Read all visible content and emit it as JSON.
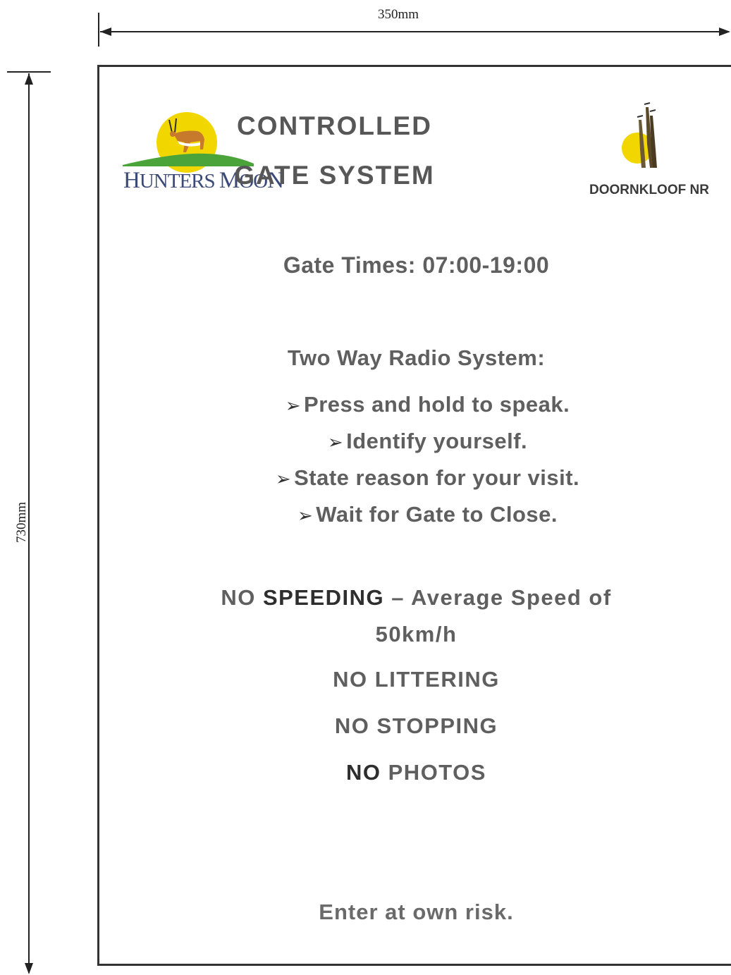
{
  "dimensions": {
    "width_label": "350mm",
    "height_label": "730mm"
  },
  "logos": {
    "left": {
      "name_first_big": "H",
      "name_first_rest": "UNTERS ",
      "name_second_big": "M",
      "name_second_rest": "OO",
      "name_second_end": "N",
      "icon": "springbok-sun-logo"
    },
    "right": {
      "text": "DOORNKLOOF NR",
      "icon": "giraffe-sun-logo"
    }
  },
  "heading": {
    "line1": "CONTROLLED",
    "line2": "GATE SYSTEM"
  },
  "gate_times": "Gate Times: 07:00-19:00",
  "radio": {
    "heading": "Two Way Radio System:",
    "bullet_glyph": "➢",
    "steps": [
      "Press and hold to speak.",
      "Identify yourself.",
      "State reason for your visit.",
      "Wait for Gate to Close."
    ]
  },
  "rules": {
    "speeding_no": "NO ",
    "speeding_word": "SPEEDING",
    "speeding_rest": " – Average Speed of",
    "speeding_line2": "50km/h",
    "littering": "NO LITTERING",
    "stopping": "NO STOPPING",
    "photos_no": "NO",
    "photos_rest": " PHOTOS"
  },
  "footer": "Enter at own risk.",
  "colors": {
    "border": "#333333",
    "text": "#5f5f5f",
    "logo_blue": "#3b4a78",
    "sun_yellow": "#f2d600",
    "hill_green": "#4aa43a"
  }
}
